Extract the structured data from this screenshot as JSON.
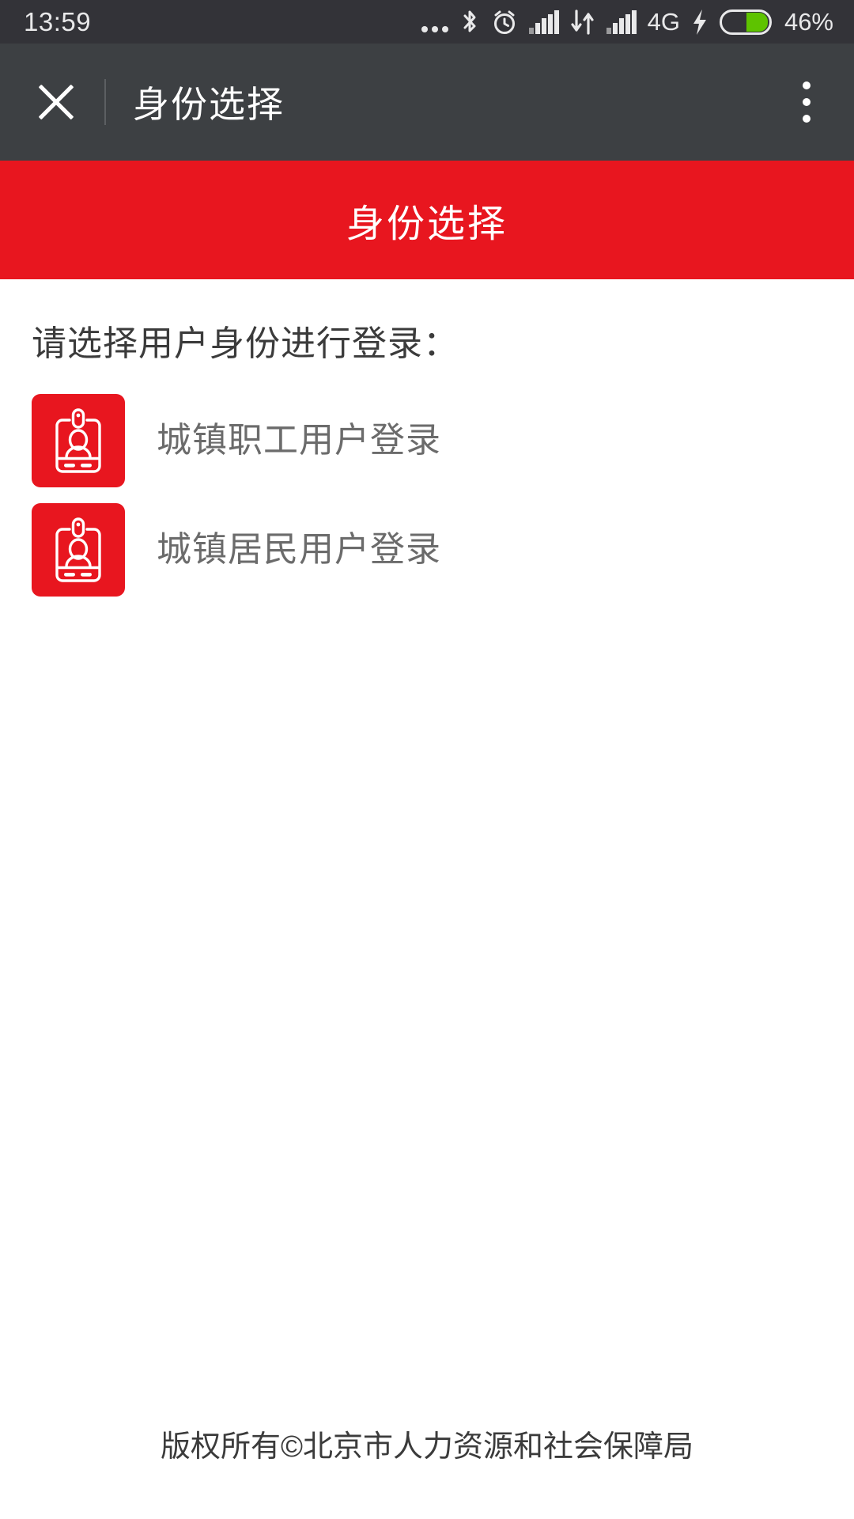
{
  "statusbar": {
    "time": "13:59",
    "network_label": "4G",
    "battery_percent": "46%",
    "icons": [
      "more-dots-icon",
      "bluetooth-icon",
      "alarm-clock-icon",
      "signal-bars-icon",
      "data-transfer-icon",
      "signal-bars-icon-2",
      "charging-bolt-icon",
      "battery-icon"
    ],
    "battery_level": 46,
    "battery_color": "#5ec300",
    "background": "#333338"
  },
  "titlebar": {
    "close_icon": "close-icon",
    "title": "身份选择",
    "overflow_icon": "overflow-menu-icon",
    "background": "#3d4043"
  },
  "banner": {
    "title": "身份选择",
    "background": "#e8161f",
    "text_color": "#ffffff"
  },
  "main": {
    "prompt": "请选择用户身份进行登录：",
    "identities": [
      {
        "icon": "id-badge-icon",
        "label": "城镇职工用户登录",
        "icon_background": "#e8161f"
      },
      {
        "icon": "id-badge-icon",
        "label": "城镇居民用户登录",
        "icon_background": "#e8161f"
      }
    ]
  },
  "footer": {
    "copyright": "版权所有©北京市人力资源和社会保障局"
  }
}
